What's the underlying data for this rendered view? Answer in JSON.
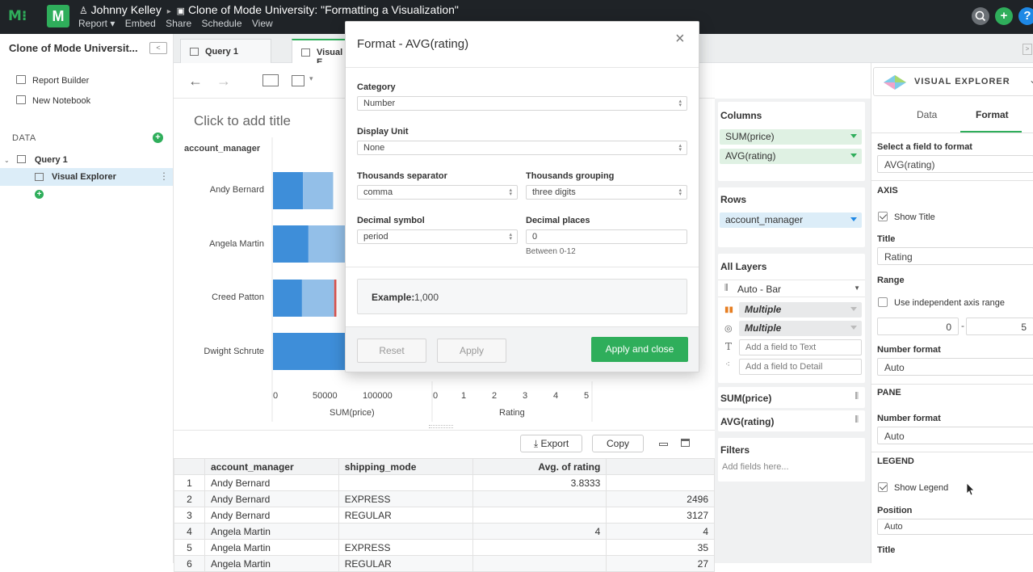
{
  "topbar": {
    "user": "Johnny Kelley",
    "separator": "▸",
    "report_title": "Clone of Mode University: \"Formatting a Visualization\"",
    "menu": [
      "Report ▾",
      "Embed",
      "Share",
      "Schedule",
      "View"
    ],
    "logo_letter": "M"
  },
  "leftpanel": {
    "title": "Clone of Mode Universit...",
    "links": [
      "Report Builder",
      "New Notebook"
    ],
    "data_header": "DATA",
    "query": "Query 1",
    "visual_explorer": "Visual Explorer"
  },
  "tabs": [
    "Query 1",
    "Visual E"
  ],
  "chart": {
    "add_title": "Click to add title",
    "row_header": "account_manager",
    "categories": [
      "Andy Bernard",
      "Angela Martin",
      "Creed Patton",
      "Dwight Schrute"
    ],
    "left_ticks": [
      "0",
      "50000",
      "100000"
    ],
    "left_axis_label": "SUM(price)",
    "right_ticks": [
      "0",
      "1",
      "2",
      "3",
      "4",
      "5"
    ],
    "right_axis_label": "Rating"
  },
  "chart_data": {
    "type": "bar",
    "categories": [
      "Andy Bernard",
      "Angela Martin",
      "Creed Patton",
      "Dwight Schrute"
    ],
    "series": [
      {
        "values": [
          28000,
          33000,
          27000,
          75000
        ]
      },
      {
        "values": [
          28000,
          40000,
          30000,
          0
        ]
      },
      {
        "values": [
          0,
          5000,
          2000,
          0
        ]
      }
    ],
    "xlabel": "SUM(price)",
    "xlim": [
      0,
      120000
    ],
    "colors": [
      "#3e8ed9",
      "#93bfe8",
      "#d9534f"
    ]
  },
  "table": {
    "export_label": "Export",
    "copy_label": "Copy",
    "headers": [
      "",
      "account_manager",
      "shipping_mode",
      "Avg. of rating",
      ""
    ],
    "rows": [
      [
        "1",
        "Andy Bernard",
        "",
        "3.8333",
        ""
      ],
      [
        "2",
        "Andy Bernard",
        "EXPRESS",
        "",
        "2496"
      ],
      [
        "3",
        "Andy Bernard",
        "REGULAR",
        "",
        "3127"
      ],
      [
        "4",
        "Angela Martin",
        "",
        "4",
        "4"
      ],
      [
        "5",
        "Angela Martin",
        "EXPRESS",
        "",
        "35"
      ],
      [
        "6",
        "Angela Martin",
        "REGULAR",
        "",
        "27"
      ]
    ]
  },
  "middle": {
    "columns_title": "Columns",
    "columns": [
      "SUM(price)",
      "AVG(rating)"
    ],
    "rows_title": "Rows",
    "rows": [
      "account_manager"
    ],
    "layers_title": "All Layers",
    "layer_type": "Auto - Bar",
    "multiple": "Multiple",
    "text_placeholder": "Add a field to Text",
    "detail_placeholder": "Add a field to Detail",
    "measures": [
      "SUM(price)",
      "AVG(rating)"
    ],
    "filters_title": "Filters",
    "filters_placeholder": "Add fields here..."
  },
  "right": {
    "brand": "VISUAL EXPLORER",
    "tab_data": "Data",
    "tab_format": "Format",
    "select_field_label": "Select a field to format",
    "select_field_value": "AVG(rating)",
    "axis_header": "AXIS",
    "show_title": "Show Title",
    "title_label": "Title",
    "title_value": "Rating",
    "range_label": "Range",
    "independent_range": "Use independent axis range",
    "range_min": "0",
    "range_dash": "-",
    "range_max": "5",
    "number_format_label": "Number format",
    "number_format_value": "Auto",
    "pane_header": "PANE",
    "pane_number_format_label": "Number format",
    "pane_number_format_value": "Auto",
    "legend_header": "LEGEND",
    "show_legend": "Show Legend",
    "position_label": "Position",
    "position_value": "Auto",
    "legend_title_label": "Title"
  },
  "modal": {
    "title": "Format - AVG(rating)",
    "close": "×",
    "category_label": "Category",
    "category_value": "Number",
    "display_unit_label": "Display Unit",
    "display_unit_value": "None",
    "thousands_sep_label": "Thousands separator",
    "thousands_sep_value": "comma",
    "thousands_group_label": "Thousands grouping",
    "thousands_group_value": "three digits",
    "decimal_symbol_label": "Decimal symbol",
    "decimal_symbol_value": "period",
    "decimal_places_label": "Decimal places",
    "decimal_places_value": "0",
    "decimal_hint": "Between 0-12",
    "example_label": "Example:",
    "example_value": "1,000",
    "reset": "Reset",
    "apply": "Apply",
    "apply_close": "Apply and close"
  },
  "colors": {
    "accent": "#2fae5b",
    "bar_dark": "#3e8ed9",
    "bar_light": "#93bfe8",
    "bar_red": "#d9534f",
    "pill_green": "#dff1e3",
    "pill_blue": "#dcedf8"
  }
}
